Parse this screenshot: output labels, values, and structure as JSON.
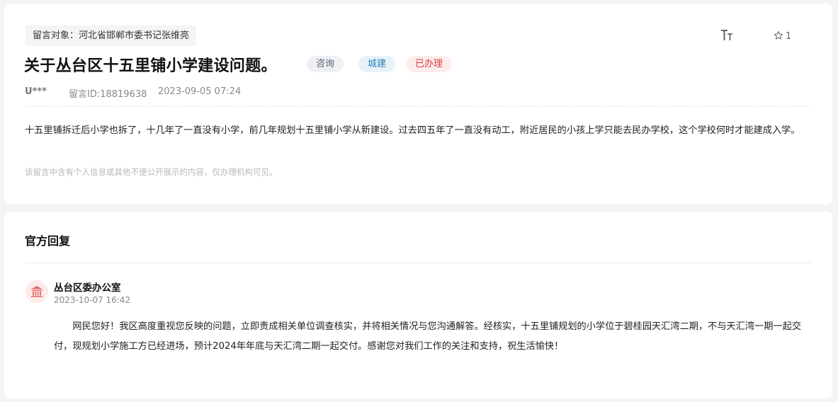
{
  "message": {
    "target": "留言对象：河北省邯郸市委书记张维亮",
    "title": "关于丛台区十五里铺小学建设问题。",
    "tags": [
      {
        "label": "咨询"
      },
      {
        "label": "城建"
      },
      {
        "label": "已办理"
      }
    ],
    "user": "U***",
    "message_id": "留言ID:18819638",
    "date": "2023-09-05 07:24",
    "content": "十五里铺拆迁后小学也拆了，十几年了一直没有小学，前几年规划十五里铺小学从新建设。过去四五年了一直没有动工，附近居民的小孩上学只能去民办学校，这个学校何时才能建成入学。",
    "privacy_notice": "该留言中含有个人信息或其他不便公开展示的内容，仅办理机构可见。",
    "favorite_count": "1",
    "font_size_icon": "font-size-icon",
    "star_icon": "star-icon"
  },
  "reply": {
    "heading": "官方回复",
    "org_icon": "government-building-icon",
    "org_name": "丛台区委办公室",
    "date": "2023-10-07 16:42",
    "content": "网民您好！我区高度重视您反映的问题，立即责成相关单位调查核实，并将相关情况与您沟通解答。经核实，十五里铺规划的小学位于碧桂园天汇湾二期，不与天汇湾一期一起交付，现规划小学施工方已经进场，预计2024年年底与天汇湾二期一起交付。感谢您对我们工作的关注和支持，祝生活愉快！"
  },
  "colors": {
    "page_background": "#f3f4f6",
    "tag_consult": "#5a6474",
    "tag_urban": "#2f7fb2",
    "tag_done": "#e04040",
    "org_icon": "#e46a6a"
  }
}
